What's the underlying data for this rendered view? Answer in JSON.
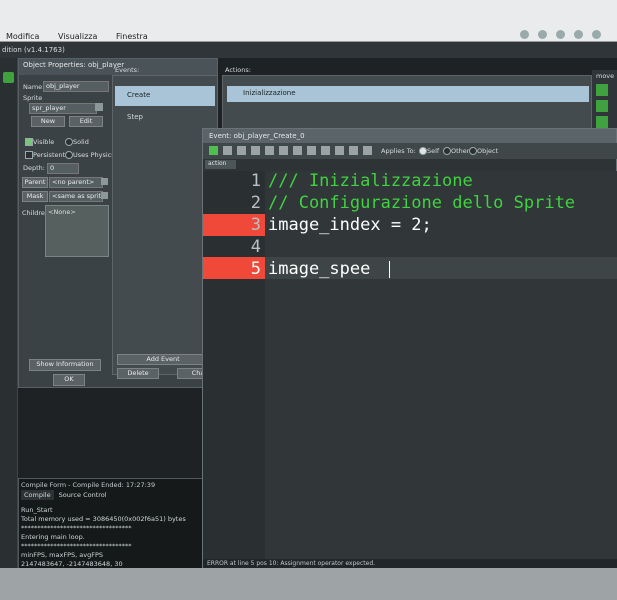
{
  "menu": {
    "items": [
      "Modifica",
      "Visualizza",
      "Finestra"
    ]
  },
  "app": {
    "title_fragment": "dition (v1.4.1763)"
  },
  "object_properties": {
    "title": "Object Properties: obj_player",
    "name_label": "Name:",
    "name_value": "obj_player",
    "sprite_label": "Sprite",
    "sprite_value": "spr_player",
    "new_button": "New",
    "edit_button": "Edit",
    "visible_label": "Visible",
    "solid_label": "Solid",
    "persistent_label": "Persistent",
    "uses_physics_label": "Uses Physics",
    "depth_label": "Depth:",
    "depth_value": "0",
    "parent_label": "Parent",
    "parent_value": "<no parent>",
    "mask_label": "Mask",
    "mask_value": "<same as sprite>",
    "children_label": "Children",
    "children_value": "<None>",
    "show_information_button": "Show Information",
    "ok_button": "OK"
  },
  "events": {
    "header": "Events:",
    "items": [
      "Create",
      "Step"
    ],
    "add_event_button": "Add Event",
    "delete_button": "Delete",
    "change_button": "Cha"
  },
  "actions": {
    "header": "Actions:",
    "items": [
      "Inizializzazione"
    ]
  },
  "right_panel": {
    "header": "move"
  },
  "compile": {
    "title": "Compile Form - Compile Ended: 17:27:39",
    "tabs": [
      "Compile",
      "Source Control"
    ],
    "log": [
      "Run_Start",
      "Total memory used = 3086450(0x002f6a51) bytes",
      "**********************************",
      "Entering main loop.",
      "**********************************",
      "minFPS, maxFPS, avgFPS",
      "2147483647, -2147483648, 30"
    ]
  },
  "editor": {
    "title": "Event: obj_player_Create_0",
    "applies_to_label": "Applies To:",
    "applies_options": [
      "Self",
      "Other",
      "Object"
    ],
    "tab_label": "action",
    "lines": [
      {
        "n": "1",
        "text": "/// Inizializzazione"
      },
      {
        "n": "2",
        "text": "// Configurazione dello Sprite"
      },
      {
        "n": "3",
        "text": "image_index = 2;"
      },
      {
        "n": "4",
        "text": ""
      },
      {
        "n": "5",
        "text": "image_spee"
      }
    ],
    "status": "ERROR at line 5 pos 10: Assignment operator expected."
  },
  "colors": {
    "comment": "#3fd33f",
    "code_text": "#ffffff",
    "error_marker": "#f0493a",
    "line_highlight": "#3e4547"
  }
}
